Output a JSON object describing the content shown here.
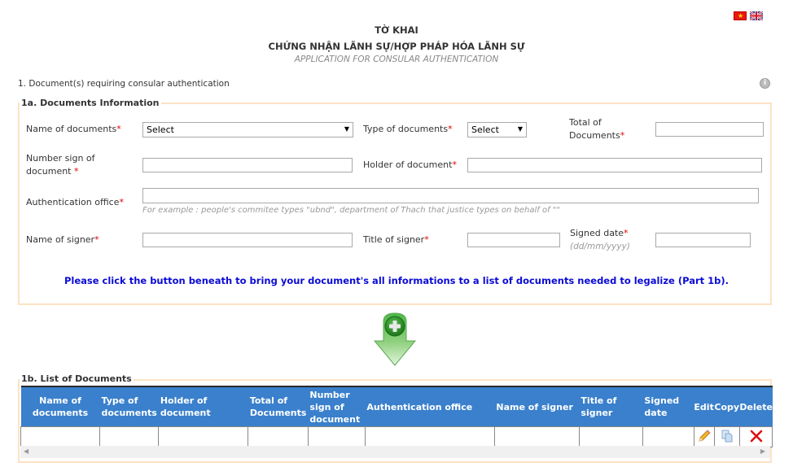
{
  "header": {
    "title_line1": "TỜ KHAI",
    "title_line2": "CHỨNG NHẬN LÃNH SỰ/HỢP PHÁP HÓA LÃNH SỰ",
    "subtitle": "APPLICATION FOR CONSULAR AUTHENTICATION",
    "languages": [
      {
        "name": "Vietnamese",
        "icon": "flag-vn-icon"
      },
      {
        "name": "English",
        "icon": "flag-uk-icon"
      }
    ]
  },
  "section1": {
    "label": "1. Document(s) requiring consular authentication",
    "info_icon": "i"
  },
  "documents_info": {
    "legend": "1a. Documents Information",
    "required_mark": "*",
    "fields": {
      "name_of_documents": {
        "label": "Name of documents",
        "value": "Select"
      },
      "type_of_documents": {
        "label": "Type of documents",
        "value": "Select"
      },
      "total_of_documents": {
        "label_line1": "Total of",
        "label_line2": "Documents",
        "value": ""
      },
      "number_sign": {
        "label_line1": "Number sign of",
        "label_line2": "document ",
        "value": ""
      },
      "holder_of_document": {
        "label": "Holder of document",
        "value": ""
      },
      "authentication_office": {
        "label": "Authentication office",
        "value": "",
        "hint": "For example : people's commitee types \"ubnd\", department of Thach that justice types on behalf of \"\""
      },
      "name_of_signer": {
        "label": "Name of signer",
        "value": ""
      },
      "title_of_signer": {
        "label": "Title of signer",
        "value": ""
      },
      "signed_date": {
        "label": "Signed date",
        "format_hint": "(dd/mm/yyyy)",
        "value": ""
      }
    },
    "notice": "Please click the button beneath to bring your document's all informations to a list of documents needed to legalize (Part 1b)."
  },
  "add_button": {
    "icon": "add-down-arrow-icon"
  },
  "documents_list": {
    "legend": "1b. List of Documents",
    "columns": [
      "Name of documents",
      "Type of documents",
      "Holder of document",
      "Total of Documents",
      "Number sign of document",
      "Authentication office",
      "Name of signer",
      "Title of signer",
      "Signed date",
      "Edit",
      "Copy",
      "Delete"
    ],
    "rows": [
      [
        "",
        "",
        "",
        "",
        "",
        "",
        "",
        "",
        ""
      ]
    ],
    "actions": {
      "edit_icon": "pencil-icon",
      "copy_icon": "copy-icon",
      "delete_icon": "x-icon"
    }
  },
  "colors": {
    "table_header": "#3a80cc",
    "fieldset_border": "#fde2c4",
    "notice_text": "#0b0bd6",
    "required": "#e00000"
  }
}
